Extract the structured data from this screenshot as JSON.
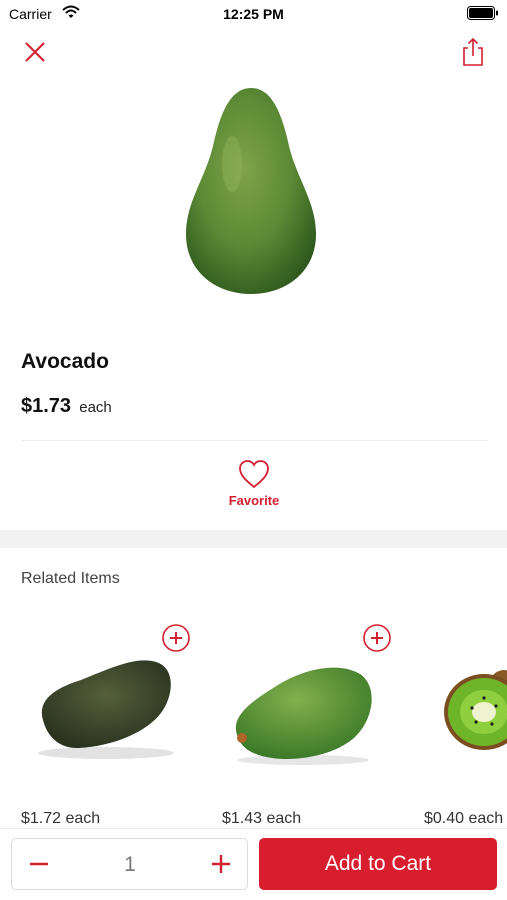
{
  "status_bar": {
    "carrier": "Carrier",
    "time": "12:25 PM",
    "icons": [
      "wifi-icon",
      "battery-icon"
    ]
  },
  "top_actions": {
    "close_icon": "close-icon",
    "share_icon": "share-icon"
  },
  "product": {
    "name": "Avocado",
    "price": "$1.73",
    "unit": "each",
    "image": "avocado-image"
  },
  "favorite": {
    "label": "Favorite",
    "icon": "heart-icon"
  },
  "related": {
    "heading": "Related Items",
    "items": [
      {
        "price": "$1.72 each",
        "image": "hass-avocado-image",
        "add_icon": "plus-circle-icon"
      },
      {
        "price": "$1.43 each",
        "image": "green-avocado-image",
        "add_icon": "plus-circle-icon"
      },
      {
        "price": "$0.40 each",
        "image": "kiwi-image"
      }
    ]
  },
  "cart": {
    "quantity": "1",
    "button_label": "Add to Cart",
    "minus_icon": "minus-icon",
    "plus_icon": "plus-icon"
  },
  "colors": {
    "accent": "#d81e2e",
    "background": "#ffffff",
    "band": "#f2f2f2"
  }
}
